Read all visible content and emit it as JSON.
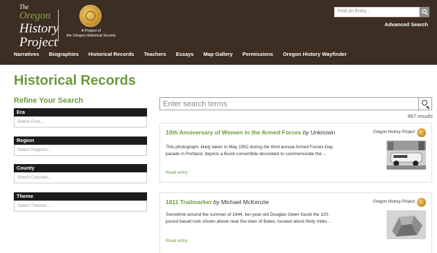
{
  "header": {
    "logo_lines": [
      "The",
      "Oregon",
      "History",
      "Project"
    ],
    "seal_caption": [
      "A Project of",
      "the Oregon Historical Society"
    ],
    "search_placeholder": "Find an Entry...",
    "advanced_search": "Advanced Search",
    "nav": [
      "Narratives",
      "Biographies",
      "Historical Records",
      "Teachers",
      "Essays",
      "Map Gallery",
      "Permissions",
      "Oregon History Wayfinder"
    ]
  },
  "page_title": "Historical Records",
  "sidebar": {
    "title": "Refine Your Search",
    "facets": [
      {
        "label": "Era",
        "placeholder": "Select Eras..."
      },
      {
        "label": "Region",
        "placeholder": "Select Regions..."
      },
      {
        "label": "County",
        "placeholder": "Select Counties..."
      },
      {
        "label": "Theme",
        "placeholder": "Select Themes..."
      }
    ]
  },
  "main": {
    "search_placeholder": "Enter search terms",
    "results_count": "867 results",
    "results": [
      {
        "title": "10th Anniversary of Women in the Armed Forces",
        "by": "by",
        "author": "Unknown",
        "description": "This photograph, likely taken in May 1952 during the third annual Armed Forces Day parade in Portland, depicts a Buick convertible decorated to commemorate the ...",
        "link": "Read entry",
        "source": "Oregon History Project"
      },
      {
        "title": "1811 Trailmarker",
        "by": "by",
        "author": "Michael McKenzie",
        "description": "Sometime around the summer of 1944, ten-year-old Douglas Owen found the 120-pound basalt rock shown above near the town of Bates, located about thirty miles ...",
        "link": "Read entry",
        "source": "Oregon History Project"
      }
    ]
  },
  "colors": {
    "header_bg": "#3c2e22",
    "accent_green": "#6b9a3a",
    "facet_header_bg": "#1c1c1c"
  }
}
